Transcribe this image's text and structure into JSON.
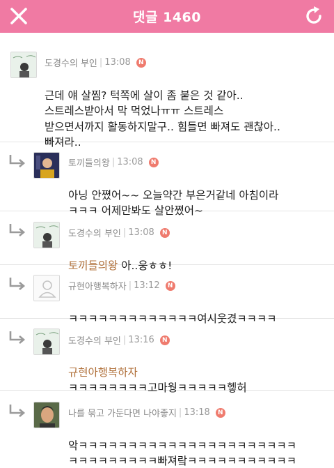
{
  "header": {
    "title": "댓글 1460",
    "accent_color": "#f07aa3",
    "close_icon": "close-icon",
    "refresh_icon": "refresh-icon"
  },
  "comments": [
    {
      "author": "도경수의 부인",
      "time": "13:08",
      "badge": "N",
      "avatar": "album-cover-avatar",
      "is_reply": false,
      "mention": "",
      "text": "근데 얘 살찜? 턱쪽에 살이 좀 붙은 것 같아..\n스트레스받아서 막 먹었나ㅠㅠ 스트레스\n받으면서까지 활동하지말구.. 힘들면 빠져도 괜찮아..\n빠져라.."
    },
    {
      "author": "토끼들의왕",
      "time": "13:08",
      "badge": "N",
      "avatar": "person-photo-avatar",
      "is_reply": true,
      "mention": "",
      "text": "아닝 안쪘어~~ 오늘약간 부은거같네 아침이라\nㅋㅋㅋ 어제만봐도 살안쪘어~"
    },
    {
      "author": "도경수의 부인",
      "time": "13:08",
      "badge": "N",
      "avatar": "album-cover-avatar",
      "is_reply": true,
      "mention": "토끼들의왕",
      "text": " 아..웅ㅎㅎ!"
    },
    {
      "author": "규현아행복하자",
      "time": "13:12",
      "badge": "N",
      "avatar": "default-user-avatar",
      "is_reply": true,
      "mention": "",
      "text": "ㅋㅋㅋㅋㅋㅋㅋㅋㅋㅋㅋㅋㅋ여시웃겼ㅋㅋㅋㅋ"
    },
    {
      "author": "도경수의 부인",
      "time": "13:16",
      "badge": "N",
      "avatar": "album-cover-avatar",
      "is_reply": true,
      "mention": "규현아행복하자",
      "text": "\nㅋㅋㅋㅋㅋㅋㅋㅋ고마웡ㅋㅋㅋㅋㅋ헿허"
    },
    {
      "author": "나를 묶고 가둔다면 나야좋지",
      "time": "13:18",
      "badge": "N",
      "avatar": "man-photo-avatar",
      "is_reply": true,
      "mention": "",
      "text": "악ㅋㅋㅋㅋㅋㅋㅋㅋㅋㅋㅋㅋㅋㅋㅋㅋㅋㅋㅋㅋㅋㅋ\nㅋㅋㅋㅋㅋㅋㅋㅋㅋ빠져랔ㅋㅋㅋㅋㅋㅋㅋㅋㅋㅋㅋ"
    }
  ]
}
